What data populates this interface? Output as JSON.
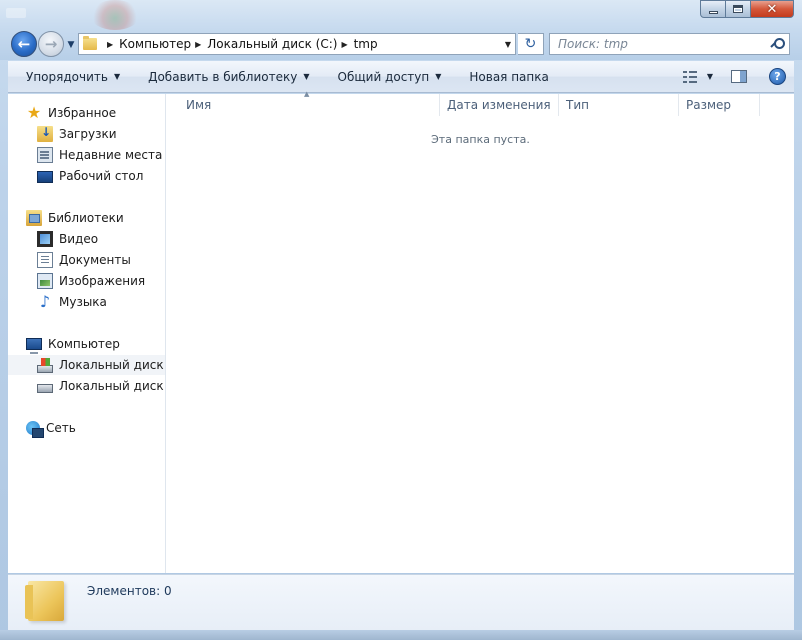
{
  "window": {
    "caption": {
      "minimize": "minimize",
      "maximize": "maximize",
      "close": "✕"
    }
  },
  "navigation": {
    "breadcrumbs": [
      "Компьютер",
      "Локальный диск (C:)",
      "tmp"
    ],
    "search_placeholder": "Поиск: tmp"
  },
  "toolbar": {
    "organize": "Упорядочить",
    "add_to_library": "Добавить в библиотеку",
    "share": "Общий доступ",
    "new_folder": "Новая папка"
  },
  "sidebar": {
    "favorites": {
      "label": "Избранное",
      "items": [
        "Загрузки",
        "Недавние места",
        "Рабочий стол"
      ]
    },
    "libraries": {
      "label": "Библиотеки",
      "items": [
        "Видео",
        "Документы",
        "Изображения",
        "Музыка"
      ]
    },
    "computer": {
      "label": "Компьютер",
      "items": [
        "Локальный диск (C",
        "Локальный диск (D"
      ]
    },
    "network": {
      "label": "Сеть"
    }
  },
  "file_list": {
    "columns": [
      "Имя",
      "Дата изменения",
      "Тип",
      "Размер"
    ],
    "empty_message": "Эта папка пуста."
  },
  "details": {
    "item_count": "Элементов: 0"
  }
}
